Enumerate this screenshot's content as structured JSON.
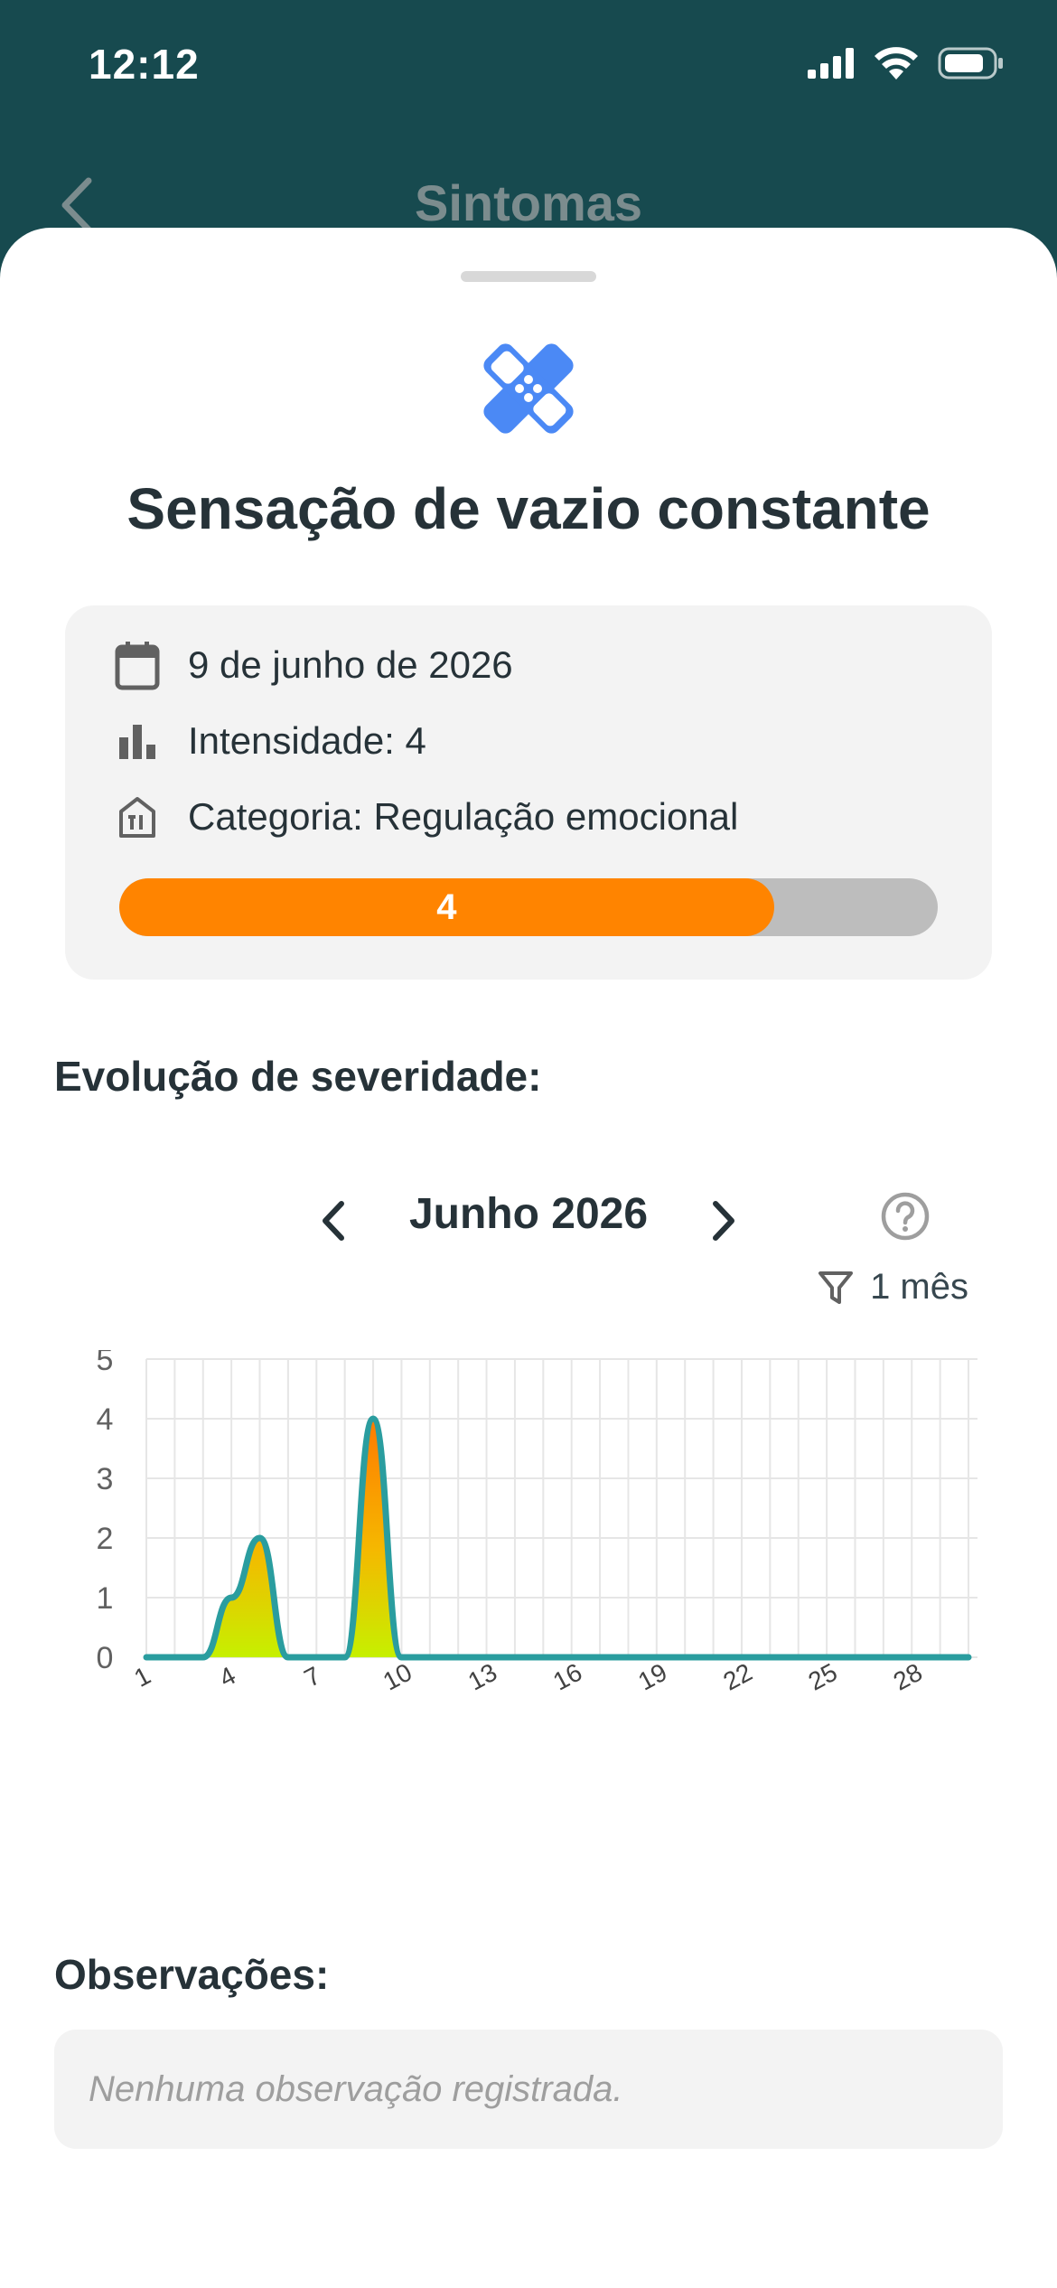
{
  "status_bar": {
    "time": "12:12"
  },
  "nav": {
    "title": "Sintomas"
  },
  "symptom": {
    "title": "Sensação de vazio constante",
    "date": "9 de junho de 2026",
    "intensity_text": "Intensidade: 4",
    "category_text": "Categoria: Regulação emocional",
    "intensity_value": "4",
    "intensity_fraction": 0.8,
    "bar_color": "#ff8400"
  },
  "chart_section": {
    "title": "Evolução de severidade:",
    "month": "Junho 2026",
    "filter_label": "1 mês"
  },
  "chart_data": {
    "type": "area",
    "x": [
      1,
      2,
      3,
      4,
      5,
      6,
      7,
      8,
      9,
      10,
      11,
      12,
      13,
      14,
      15,
      16,
      17,
      18,
      19,
      20,
      21,
      22,
      23,
      24,
      25,
      26,
      27,
      28,
      29,
      30
    ],
    "values": [
      0,
      0,
      0,
      1,
      2,
      0,
      0,
      0,
      4,
      0,
      0,
      0,
      0,
      0,
      0,
      0,
      0,
      0,
      0,
      0,
      0,
      0,
      0,
      0,
      0,
      0,
      0,
      0,
      0,
      0
    ],
    "x_ticks": [
      1,
      4,
      7,
      10,
      13,
      16,
      19,
      22,
      25,
      28
    ],
    "y_ticks": [
      0,
      1,
      2,
      3,
      4,
      5
    ],
    "ylim": [
      0,
      5
    ],
    "grid": true,
    "line_color": "#2a9d9f",
    "fill_gradient": [
      "#c6f000",
      "#f5b800",
      "#ff7a00"
    ]
  },
  "observations": {
    "title": "Observações:",
    "text": "Nenhuma observação registrada."
  }
}
